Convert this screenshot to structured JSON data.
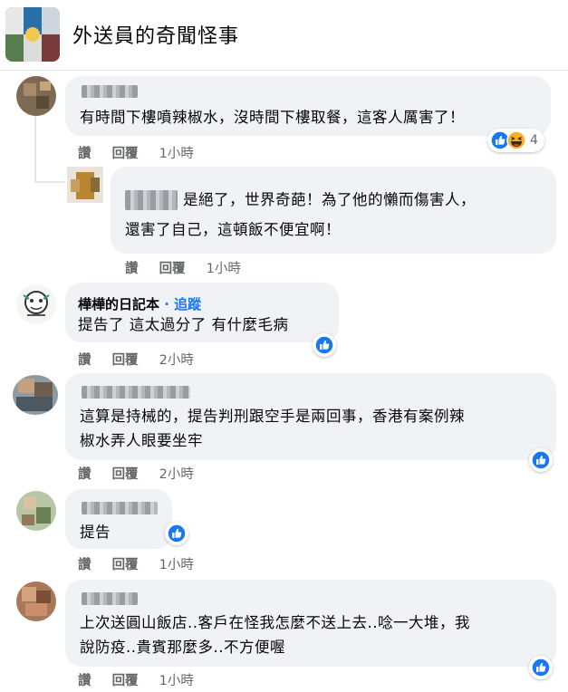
{
  "header": {
    "group_name": "外送員的奇聞怪事"
  },
  "action_labels": {
    "like": "讚",
    "reply": "回覆"
  },
  "comments": [
    {
      "author": "",
      "author_blurred": true,
      "text_lines": [
        "有時間下樓噴辣椒水，沒時間下樓取餐，這客人厲害了！"
      ],
      "time": "1小時",
      "reactions": {
        "types": [
          "like-icon",
          "haha-icon"
        ],
        "count": "4"
      },
      "reply": {
        "author": "",
        "author_blurred": true,
        "text_lines": [
          "是絕了，世界奇葩！為了他的懶而傷害人，",
          "還害了自己，這頓飯不便宜啊！"
        ],
        "time": "1小時"
      }
    },
    {
      "author": "樺樺的日記本",
      "follow_label": "· 追蹤",
      "text_lines": [
        "提告了 這太過分了 有什麼毛病"
      ],
      "time": "2小時",
      "reactions": {
        "types": [
          "like-icon"
        ],
        "count": ""
      }
    },
    {
      "author": "",
      "author_blurred": true,
      "text_lines": [
        "這算是持械的，提告判刑跟空手是兩回事，香港有案例辣",
        "椒水弄人眼要坐牢"
      ],
      "time": "2小時",
      "reactions": {
        "types": [
          "like-icon"
        ],
        "count": ""
      }
    },
    {
      "author": "",
      "author_blurred": true,
      "text_lines": [
        "提告"
      ],
      "time": "1小時",
      "reactions": {
        "types": [
          "like-icon"
        ],
        "count": ""
      }
    },
    {
      "author": "",
      "author_blurred": true,
      "text_lines": [
        "上次送圓山飯店..客戶在怪我怎麼不送上去..唸一大堆，我",
        "說防疫..貴賓那麼多..不方便喔"
      ],
      "time": "1小時",
      "reactions": {
        "types": [
          "like-icon"
        ],
        "count": ""
      }
    }
  ],
  "colors": {
    "bubble": "#f0f2f5",
    "action_text": "#65676b",
    "like_blue": "#1877f2",
    "haha_yellow": "#f7b125"
  }
}
